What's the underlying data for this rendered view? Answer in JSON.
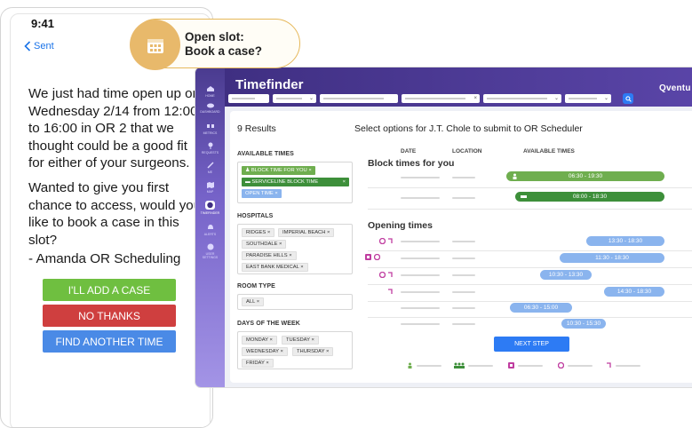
{
  "phone": {
    "time": "9:41",
    "back_label": "Sent",
    "message_p1": "We just had time open up on Wednesday 2/14 from 12:00 to 16:00 in OR 2 that we thought could be a good fit for either of your surgeons.",
    "message_p2": "Wanted to give you first chance to access, would you like to book a case in this slot?",
    "message_p3": "- Amanda OR Scheduling",
    "buttons": {
      "add": "I'LL ADD A CASE",
      "no": "NO THANKS",
      "find": "FIND ANOTHER TIME"
    }
  },
  "callout": {
    "line1": "Open slot:",
    "line2": "Book a case?",
    "icon": "calendar-icon"
  },
  "app": {
    "title": "Timefinder",
    "brand": "Qventu",
    "results": "9 Results",
    "select_options": "Select options for J.T. Chole to submit to OR Scheduler",
    "filters": {
      "available_times_label": "AVAILABLE TIMES",
      "available_times": [
        "BLOCK TIME FOR YOU",
        "SERVICELINE BLOCK TIME",
        "OPEN TIME"
      ],
      "hospitals_label": "HOSPITALS",
      "hospitals": [
        "RIDGES",
        "IMPERIAL BEACH",
        "SOUTHDALE",
        "PARADISE HILLS",
        "EAST BANK MEDICAL"
      ],
      "room_type_label": "ROOM TYPE",
      "room_type": [
        "ALL"
      ],
      "days_label": "DAYS OF THE WEEK",
      "days": [
        "MONDAY",
        "TUESDAY",
        "WEDNESDAY",
        "THURSDAY",
        "FRIDAY"
      ]
    },
    "columns": {
      "date": "DATE",
      "location": "LOCATION",
      "available_times": "AVAILABLE TIMES"
    },
    "block_heading": "Block times for you",
    "block_rows": [
      "06:30 - 19:30",
      "08:00 - 18:30"
    ],
    "opening_heading": "Opening times",
    "opening_rows": [
      "13:30 - 18:30",
      "11:30 - 18:30",
      "10:30 - 13:30",
      "14:30 - 18:30",
      "06:30 - 15:00",
      "10:30 - 15:30"
    ],
    "next_step": "NEXT STEP",
    "rail": [
      "HOME",
      "DASHBOARD",
      "METRICS",
      "REQUESTS",
      "ME",
      "MAP",
      "TIMEFINDER",
      "ALERTS",
      "USER SETTINGS"
    ],
    "colors": {
      "block_for_you": "#6fae4f",
      "serviceline": "#3d8f3a",
      "open": "#8ab4ee",
      "accent": "#2d7bf4",
      "header": "#4a3b8f"
    }
  }
}
